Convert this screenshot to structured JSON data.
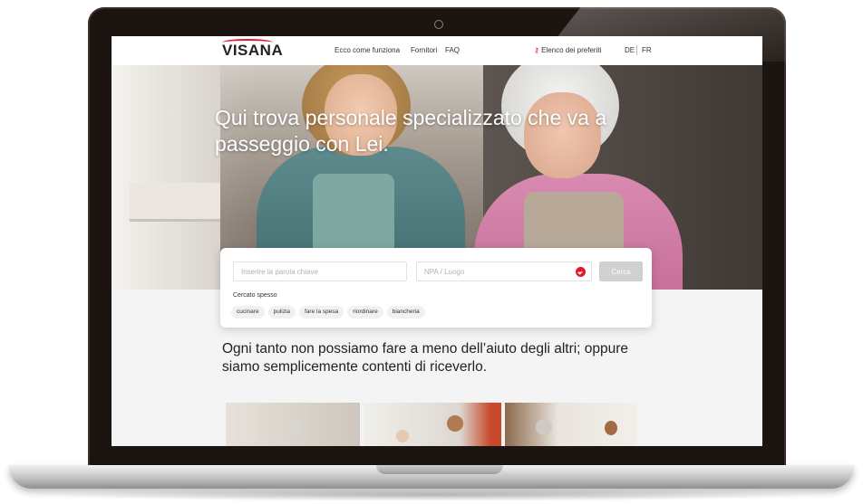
{
  "nav": {
    "logo": "VISANA",
    "links": [
      "Ecco come funziona",
      "Fornitori",
      "FAQ"
    ],
    "favorites": "Elenco dei preferiti",
    "languages": [
      "DE",
      "FR"
    ]
  },
  "hero": {
    "headline": "Qui trova personale specializzato che va a passeggio con Lei."
  },
  "search": {
    "keyword_placeholder": "Inserire la parola chiave",
    "location_placeholder": "NPA / Luogo",
    "button_label": "Cerca",
    "often_label": "Cercato spesso",
    "chips": [
      "cucinare",
      "pulizia",
      "fare la spesa",
      "riordinare",
      "biancheria"
    ]
  },
  "tagline": "Ogni tanto non possiamo fare a meno dell’aiuto degli altri; oppure siamo semplicemente contenti di riceverlo.",
  "colors": {
    "brand_red": "#e3192b",
    "button_gray": "#d0d0d0",
    "bezel": "#1b1410"
  },
  "icons": [
    "search-key-icon",
    "location-arrow-icon",
    "camera-icon"
  ]
}
